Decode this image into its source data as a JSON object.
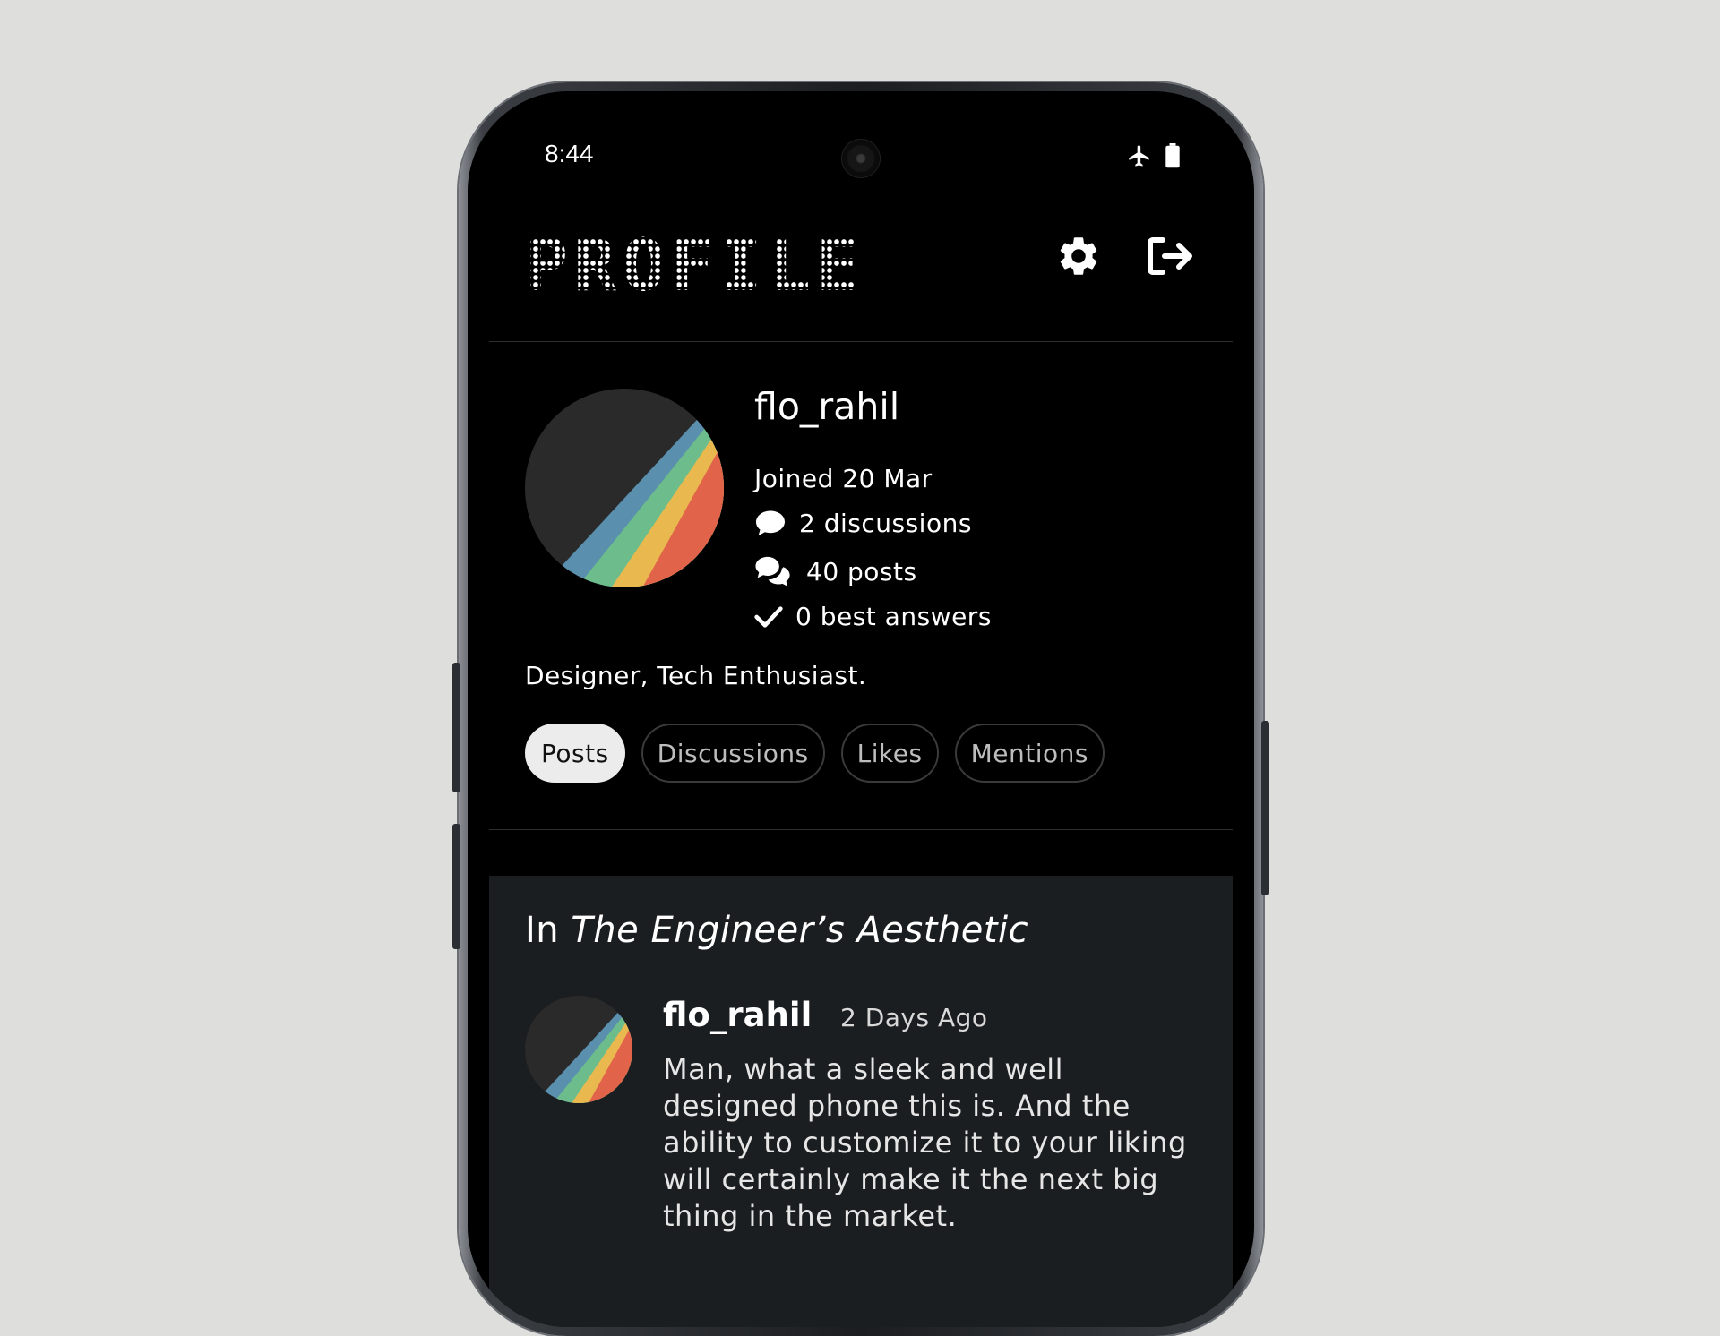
{
  "status_bar": {
    "time": "8:44",
    "icons": [
      "airplane-mode-icon",
      "battery-icon"
    ]
  },
  "header": {
    "title": "PROFILE",
    "settings_icon": "gear-icon",
    "logout_icon": "logout-icon"
  },
  "profile": {
    "username": "flo_rahil",
    "joined": "Joined 20 Mar",
    "discussions": "2 discussions",
    "posts": "40 posts",
    "best_answers": "0 best answers",
    "bio": "Designer, Tech Enthusiast.",
    "avatar_colors": [
      "#2a2a2a",
      "#5a8fad",
      "#6cbd8b",
      "#e9b94f",
      "#e0634a"
    ]
  },
  "tabs": [
    {
      "label": "Posts",
      "active": true
    },
    {
      "label": "Discussions",
      "active": false
    },
    {
      "label": "Likes",
      "active": false
    },
    {
      "label": "Mentions",
      "active": false
    }
  ],
  "post": {
    "prefix": "In",
    "discussion_title": "The Engineer’s Aesthetic",
    "author": "flo_rahil",
    "time": "2 Days Ago",
    "body": "Man, what a sleek and well designed phone this is. And the ability to customize it to your liking will certainly make it the next big thing in the market."
  }
}
